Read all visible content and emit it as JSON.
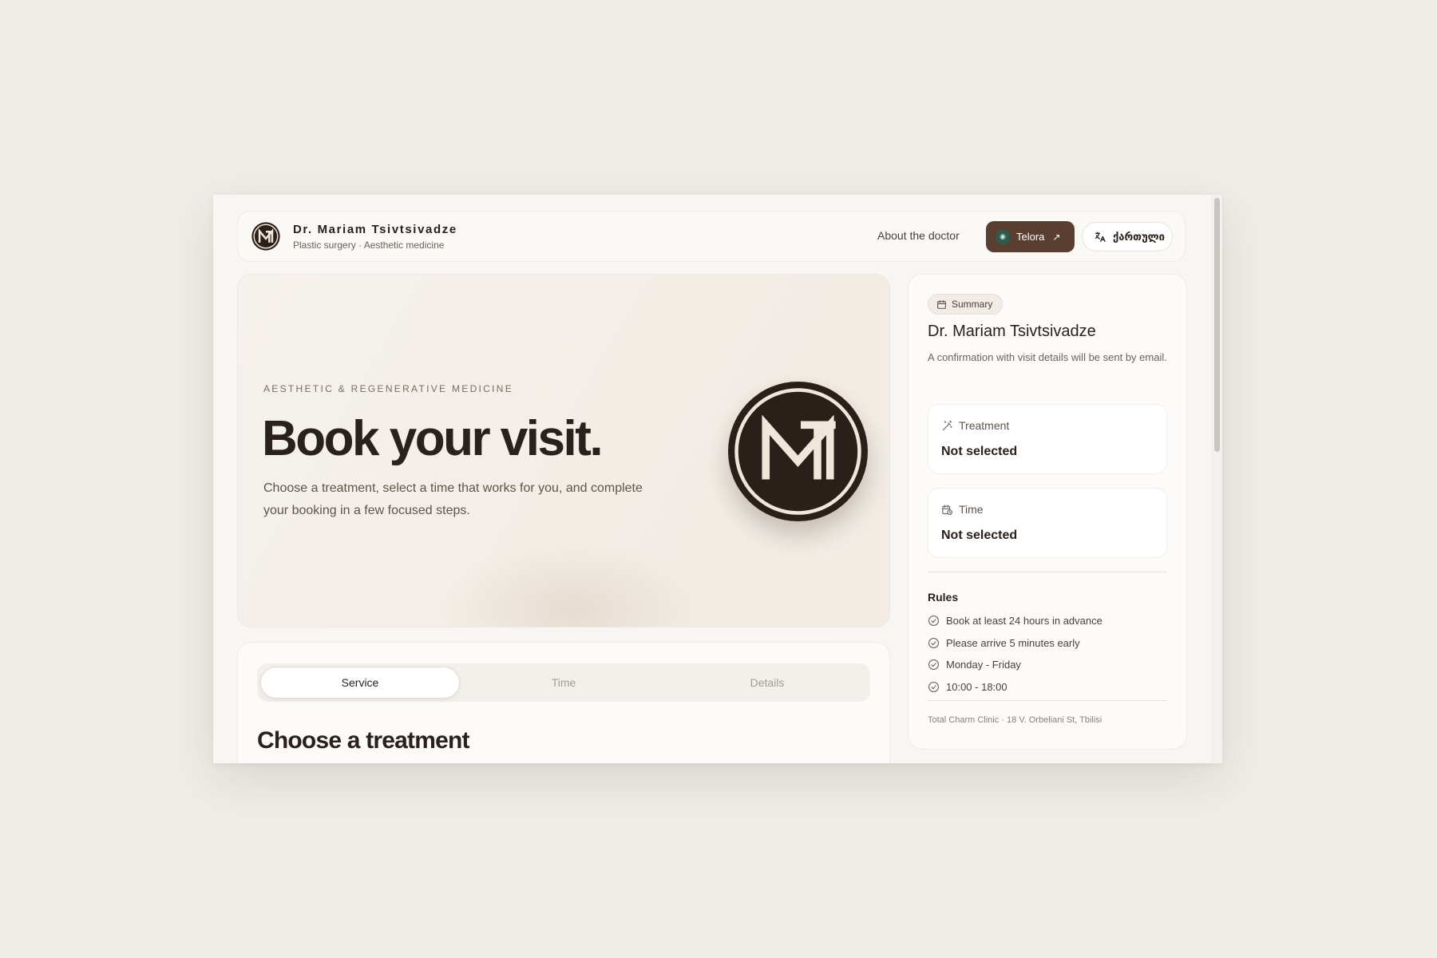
{
  "header": {
    "doctor_name": "Dr. Mariam Tsivtsivadze",
    "specialty": "Plastic surgery · Aesthetic medicine",
    "nav_about": "About the doctor",
    "telora_label": "Telora",
    "language_label": "ქართული"
  },
  "hero": {
    "eyebrow": "AESTHETIC & REGENERATIVE MEDICINE",
    "title": "Book your visit.",
    "description": "Choose a treatment, select a time that works for you, and complete your booking in a few focused steps."
  },
  "steps": {
    "tabs": [
      {
        "label": "Service",
        "active": true
      },
      {
        "label": "Time",
        "active": false
      },
      {
        "label": "Details",
        "active": false
      }
    ],
    "section_title": "Choose a treatment"
  },
  "summary": {
    "badge": "Summary",
    "doctor_name": "Dr. Mariam Tsivtsivadze",
    "confirmation_note": "A confirmation with visit details will be sent by email.",
    "treatment": {
      "label": "Treatment",
      "value": "Not selected"
    },
    "time": {
      "label": "Time",
      "value": "Not selected"
    },
    "rules_title": "Rules",
    "rules": [
      "Book at least 24 hours in advance",
      "Please arrive 5 minutes early",
      "Monday - Friday",
      "10:00 - 18:00"
    ],
    "address": "Total Charm Clinic · 18 V. Orbeliani St, Tbilisi"
  },
  "icons": {
    "brand_logo": "mt-monogram-icon",
    "telora": "telora-logo-icon",
    "external": "arrow-up-right-icon",
    "language": "translate-icon",
    "summary": "calendar-icon",
    "treatment": "magic-wand-icon",
    "time": "calendar-clock-icon",
    "rule": "check-circle-icon"
  },
  "colors": {
    "background": "#f0ede8",
    "accent_brown": "#5a3f30",
    "logo_dark": "#2b1f19",
    "logo_ring": "#f1e6da",
    "text_primary": "#2a211c"
  }
}
